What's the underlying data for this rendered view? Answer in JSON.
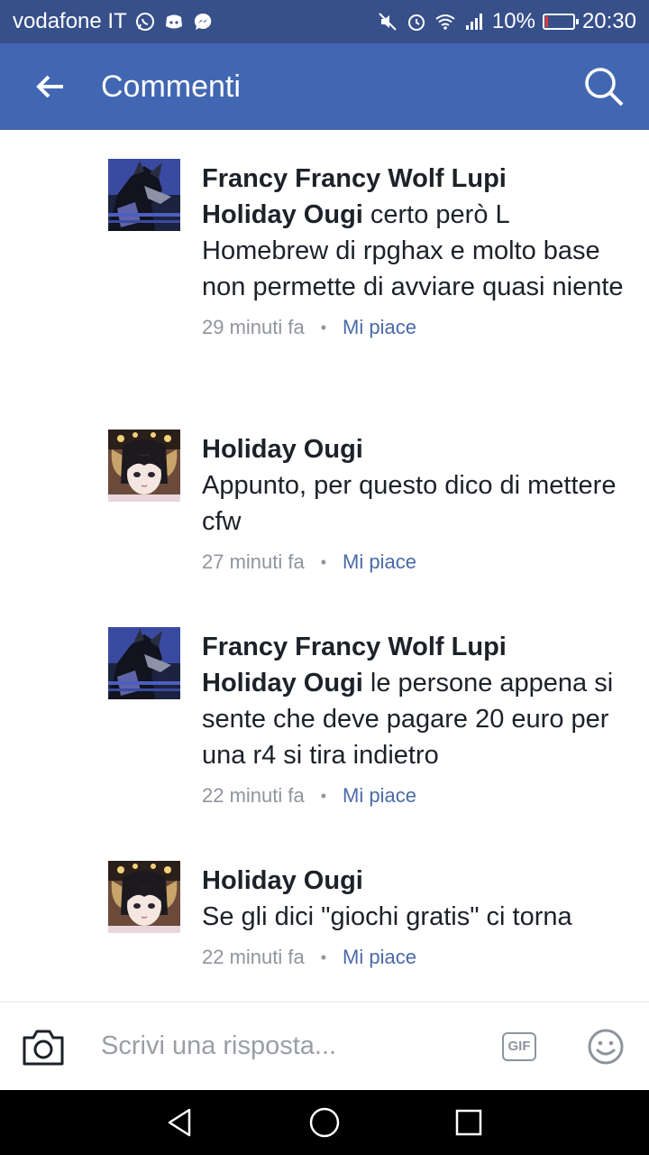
{
  "status_bar": {
    "carrier": "vodafone IT",
    "battery_percent": "10%",
    "battery_level": 0.1,
    "time": "20:30",
    "icons": [
      "whatsapp-icon",
      "discord-icon",
      "messenger-icon",
      "mute-icon",
      "alarm-icon",
      "wifi-icon",
      "signal-icon",
      "battery-icon"
    ]
  },
  "header": {
    "title": "Commenti",
    "back_icon": "back-arrow-icon",
    "search_icon": "search-icon",
    "background": "#4267b2"
  },
  "comments": [
    {
      "author": "Francy Francy Wolf Lupi",
      "mention": "Holiday Ougi",
      "text": " certo però L Homebrew di rpghax e molto base non permette di avviare quasi niente",
      "time": "29 minuti fa",
      "like_label": "Mi piace",
      "avatar": "wolf-avatar"
    },
    {
      "author": "Holiday Ougi",
      "mention": "",
      "text": "Appunto, per questo dico di mettere cfw",
      "time": "27 minuti fa",
      "like_label": "Mi piace",
      "avatar": "anime-girl-avatar"
    },
    {
      "author": "Francy Francy Wolf Lupi",
      "mention": "Holiday Ougi",
      "text": " le persone appena si sente che deve pagare 20 euro per una r4 si tira indietro",
      "time": "22 minuti fa",
      "like_label": "Mi piace",
      "avatar": "wolf-avatar"
    },
    {
      "author": "Holiday Ougi",
      "mention": "",
      "text": "Se gli dici \"giochi gratis\" ci torna",
      "time": "22 minuti fa",
      "like_label": "Mi piace",
      "avatar": "anime-girl-avatar"
    }
  ],
  "composer": {
    "placeholder": "Scrivi una risposta...",
    "gif_label": "GIF",
    "camera_icon": "camera-icon",
    "emoji_icon": "emoji-icon"
  },
  "nav_bar": {
    "icons": [
      "back-triangle-icon",
      "home-circle-icon",
      "recents-square-icon"
    ]
  }
}
